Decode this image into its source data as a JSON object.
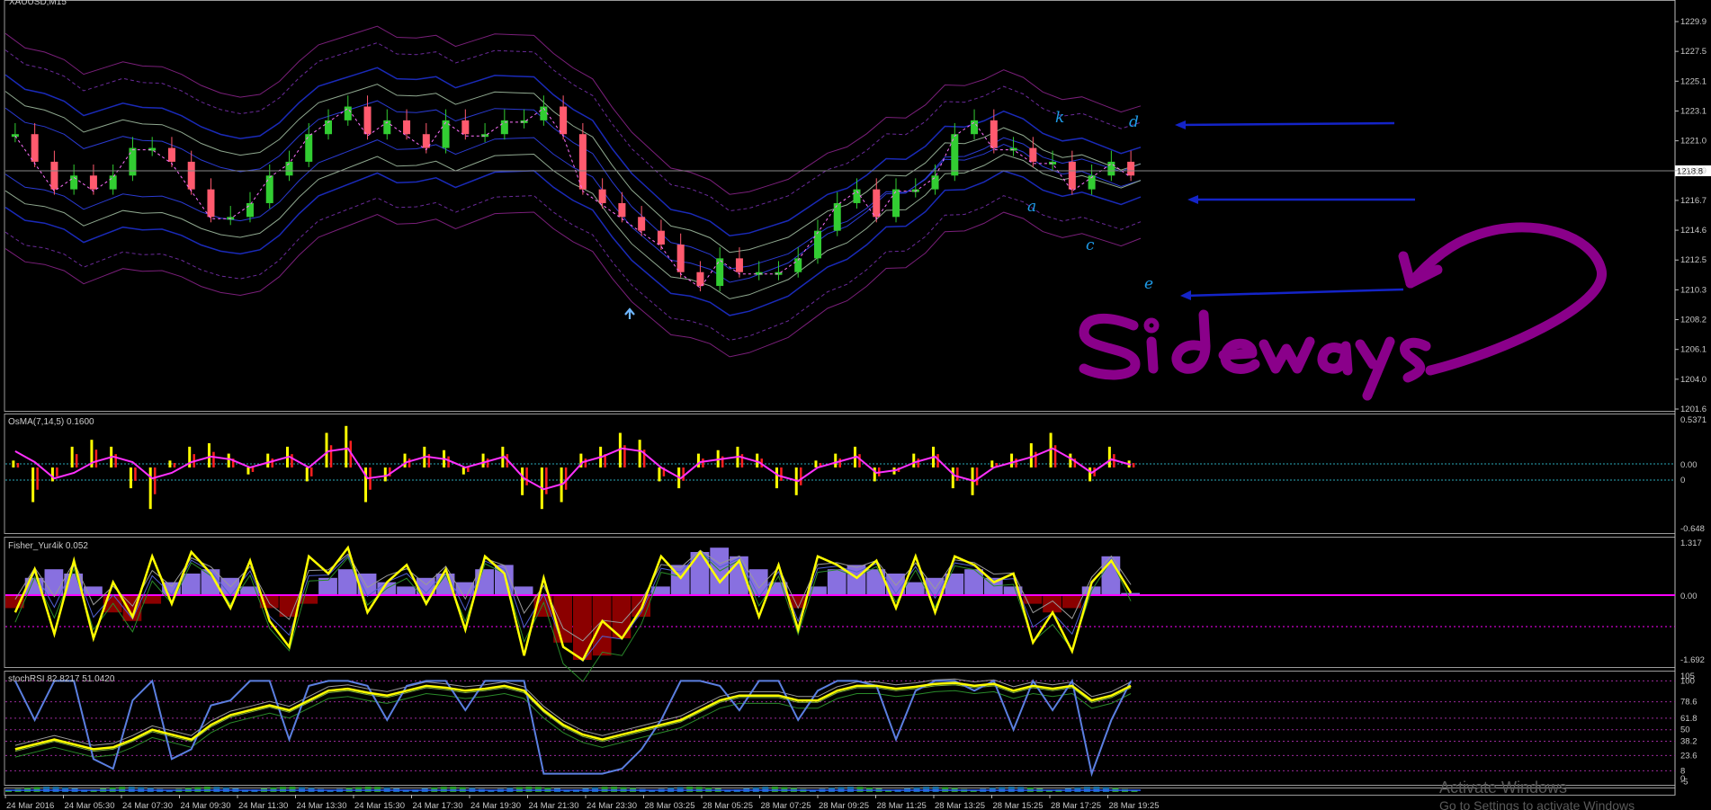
{
  "colors": {
    "background": "#000000",
    "bull_candle": "#32cd32",
    "bear_candle": "#ff5a6e",
    "osma_signal": "#ff30ff",
    "osma_up": "#ffff00",
    "osma_down": "#ff2020",
    "fisher_line": "#ffff00",
    "fisher_pos_hist": "#8870e0",
    "fisher_neg_hist": "#8b0000",
    "fisher_zero": "#ff00ff",
    "stoch_blue": "#5b7fe0",
    "stoch_yellow": "#ffff00",
    "annotation": "#8a008a",
    "arrow": "#1424c8",
    "letter": "#1e9be8"
  },
  "chart_data": [
    {
      "type": "line",
      "name": "main",
      "title": "XAUUSD,M15",
      "ylim": [
        1201.6,
        1230.2
      ],
      "yticks": [
        "1229.9",
        "1227.5",
        "1225.1",
        "1223.1",
        "1221.0",
        "1218.9",
        "1216.7",
        "1214.6",
        "1212.5",
        "1210.3",
        "1208.2",
        "1206.1",
        "1204.0",
        "1201.6"
      ],
      "price_line": "1218.8",
      "candles": [
        1221,
        1219,
        1217,
        1218,
        1217,
        1218,
        1220,
        1220,
        1219,
        1217,
        1215,
        1215,
        1216,
        1218,
        1219,
        1221,
        1222,
        1223,
        1221,
        1222,
        1221,
        1220,
        1222,
        1221,
        1221,
        1222,
        1222,
        1223,
        1221,
        1217,
        1216,
        1215,
        1214,
        1213,
        1211,
        1210,
        1212,
        1211,
        1211,
        1211,
        1212,
        1214,
        1216,
        1217,
        1215,
        1217,
        1217,
        1218,
        1221,
        1222,
        1220,
        1220,
        1219,
        1219,
        1217,
        1218,
        1219,
        1218
      ]
    },
    {
      "type": "bar",
      "name": "osma",
      "title": "OsMA(7,14,5) 0.1600",
      "yticks": [
        "0.5371",
        "0.00",
        "0",
        "-0.648"
      ],
      "values": [
        0.1,
        -0.5,
        -0.2,
        0.3,
        0.4,
        0.3,
        -0.3,
        -0.6,
        0.1,
        0.3,
        0.35,
        0.2,
        -0.1,
        0.2,
        0.3,
        -0.2,
        0.5,
        0.6,
        -0.5,
        -0.2,
        0.2,
        0.3,
        0.25,
        -0.1,
        0.2,
        0.3,
        -0.4,
        -0.6,
        -0.5,
        0.2,
        0.3,
        0.5,
        0.4,
        -0.2,
        -0.3,
        0.2,
        0.25,
        0.3,
        0.2,
        -0.3,
        -0.4,
        0.1,
        0.2,
        0.3,
        -0.2,
        -0.1,
        0.2,
        0.3,
        -0.3,
        -0.4,
        0.1,
        0.2,
        0.35,
        0.5,
        0.2,
        -0.2,
        0.3,
        0.1
      ],
      "signal": [
        0.3,
        0.1,
        -0.2,
        -0.1,
        0.1,
        0.2,
        0.1,
        -0.2,
        -0.1,
        0.1,
        0.2,
        0.15,
        0,
        0.1,
        0.2,
        0,
        0.3,
        0.35,
        -0.2,
        -0.15,
        0.1,
        0.2,
        0.15,
        0,
        0.1,
        0.2,
        -0.2,
        -0.4,
        -0.3,
        0.1,
        0.2,
        0.35,
        0.3,
        0,
        -0.2,
        0.1,
        0.15,
        0.2,
        0.1,
        -0.15,
        -0.25,
        0,
        0.1,
        0.2,
        -0.1,
        -0.05,
        0.1,
        0.2,
        -0.15,
        -0.25,
        0,
        0.1,
        0.2,
        0.35,
        0.15,
        -0.1,
        0.15,
        0.05
      ]
    },
    {
      "type": "bar",
      "name": "fisher",
      "title": "Fisher_Yur4ik 0.052",
      "yticks": [
        "1.317",
        "0.00",
        "-1.692"
      ],
      "values": [
        -0.3,
        0.4,
        0.6,
        0.5,
        0.2,
        -0.4,
        -0.6,
        -0.2,
        0.3,
        0.5,
        0.6,
        0.4,
        0.2,
        -0.3,
        -0.5,
        -0.2,
        0.4,
        0.6,
        0.5,
        0.3,
        0.2,
        0.4,
        0.5,
        0.3,
        0.6,
        0.7,
        0.2,
        -0.5,
        -1.1,
        -1.5,
        -1.4,
        -1.0,
        -0.5,
        0.2,
        0.7,
        1.0,
        1.1,
        0.9,
        0.6,
        0.3,
        -0.3,
        0.2,
        0.6,
        0.7,
        0.6,
        0.5,
        0.3,
        0.4,
        0.5,
        0.6,
        0.4,
        0.2,
        -0.2,
        -0.4,
        -0.3,
        0.2,
        0.9,
        0.05
      ],
      "signal": [
        -0.4,
        0.6,
        -0.9,
        0.8,
        -1.0,
        0.3,
        -0.5,
        0.9,
        -0.2,
        1.0,
        0.5,
        -0.3,
        0.8,
        -0.6,
        -1.2,
        0.9,
        0.5,
        1.1,
        -0.4,
        0.3,
        0.7,
        -0.2,
        0.6,
        -0.8,
        0.9,
        0.5,
        -1.4,
        0.4,
        -1.2,
        -1.5,
        -0.6,
        -1.0,
        -0.3,
        0.9,
        0.4,
        1.0,
        0.3,
        0.8,
        -0.5,
        0.7,
        -0.8,
        0.9,
        0.7,
        0.4,
        0.8,
        -0.3,
        0.9,
        -0.4,
        0.9,
        0.7,
        0.3,
        0.5,
        -1.1,
        -0.4,
        -1.3,
        0.3,
        0.8,
        0.05
      ]
    },
    {
      "type": "line",
      "name": "stochrsi",
      "title": "stochRSI 82.8217 51.0420",
      "ylim": [
        0,
        105
      ],
      "yticks": [
        "105",
        "100",
        "78.6",
        "61.8",
        "50",
        "38.2",
        "23.6",
        "8",
        "-5",
        "0"
      ],
      "blue": [
        100,
        60,
        100,
        100,
        20,
        10,
        80,
        100,
        20,
        30,
        75,
        80,
        100,
        100,
        40,
        95,
        100,
        100,
        95,
        60,
        95,
        100,
        100,
        70,
        100,
        100,
        100,
        5,
        5,
        5,
        5,
        10,
        30,
        60,
        100,
        100,
        95,
        70,
        100,
        100,
        60,
        90,
        100,
        100,
        95,
        40,
        90,
        100,
        100,
        90,
        100,
        50,
        100,
        70,
        100,
        5,
        60,
        100
      ],
      "yellow": [
        30,
        35,
        40,
        35,
        30,
        32,
        40,
        50,
        45,
        40,
        55,
        65,
        70,
        75,
        70,
        80,
        90,
        92,
        88,
        85,
        90,
        95,
        93,
        90,
        92,
        95,
        90,
        70,
        55,
        45,
        40,
        45,
        50,
        55,
        60,
        70,
        80,
        85,
        85,
        85,
        80,
        80,
        90,
        95,
        95,
        92,
        94,
        97,
        98,
        95,
        97,
        90,
        95,
        92,
        95,
        80,
        85,
        95
      ]
    },
    {
      "type": "bar",
      "name": "histogram-strip",
      "values": []
    }
  ],
  "xaxis": {
    "labels": [
      "24 Mar 2016",
      "24 Mar 05:30",
      "24 Mar 07:30",
      "24 Mar 09:30",
      "24 Mar 11:30",
      "24 Mar 13:30",
      "24 Mar 15:30",
      "24 Mar 17:30",
      "24 Mar 19:30",
      "24 Mar 21:30",
      "24 Mar 23:30",
      "28 Mar 03:25",
      "28 Mar 05:25",
      "28 Mar 07:25",
      "28 Mar 09:25",
      "28 Mar 11:25",
      "28 Mar 13:25",
      "28 Mar 15:25",
      "28 Mar 17:25",
      "28 Mar 19:25"
    ]
  },
  "annotations": {
    "letters": [
      "k",
      "d",
      "a",
      "c",
      "e"
    ],
    "handwritten": "Sideways"
  },
  "watermark": {
    "line1": "Activate Windows",
    "line2": "Go to Settings to activate Windows"
  }
}
